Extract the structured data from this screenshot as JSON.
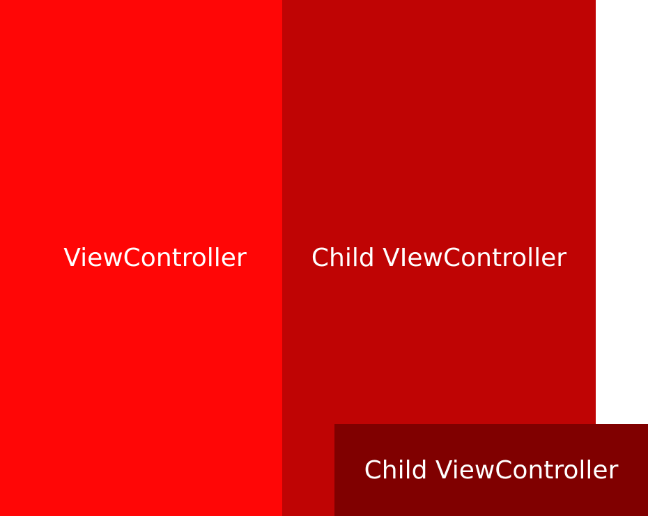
{
  "colors": {
    "background": "#ffffff",
    "main": "#ff0606",
    "child": "#bf0404",
    "nested_child": "#800000",
    "text": "#ffffff"
  },
  "panels": {
    "main": {
      "label": "ViewController"
    },
    "child": {
      "label": "Child VIewController"
    },
    "nested_child": {
      "label": "Child ViewController"
    }
  }
}
